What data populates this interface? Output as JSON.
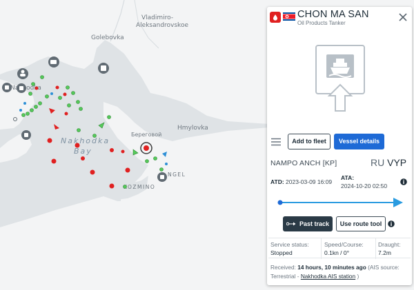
{
  "map": {
    "labels": {
      "vladimiro": "Vladimiro-",
      "aleksandrovskoe": "Aleksandrovskoe",
      "golebovka": "Golebovka",
      "nakhodka_city": "Nakhodka",
      "beregovoi": "Береговой",
      "hmylovka": "Hmylovka",
      "bay_line1": "Nakhodka",
      "bay_line2": "Bay",
      "kozmino": "KOZMINO",
      "nagel": "NGEL"
    },
    "colors": {
      "land": "#f3f4f5",
      "sea": "#dfe3e6",
      "tanker": "#e02020",
      "cargo": "#55c95a",
      "passenger": "#2d8fd6",
      "route": "#2a9be0"
    }
  },
  "panel": {
    "vessel_name": "CHON MA SAN",
    "vessel_type": "Oil Products Tanker",
    "flag": "north-korea-flag",
    "add_to_fleet": "Add to fleet",
    "vessel_details": "Vessel details",
    "departure": "NAMPO ANCH [KP]",
    "dest_country": "RU",
    "dest_port": "VYP",
    "atd_label": "ATD:",
    "atd_value": "2023-03-09 16:09",
    "ata_label": "ATA:",
    "ata_value": "2024-10-20 02:50",
    "progress": 1.0,
    "past_track": "Past track",
    "route_tool": "Use route tool",
    "service_status_label": "Service status:",
    "service_status_value": "Stopped",
    "speed_course_label": "Speed/Course:",
    "speed_course_value": "0.1kn / 0°",
    "draught_label": "Draught:",
    "draught_value": "7.2m",
    "received_label": "Received:",
    "received_value": "14 hours, 10 minutes ago",
    "ais_source_text": "(AIS source: Terrestrial -",
    "ais_station": "Nakhodka AIS station",
    "ais_close": ")"
  }
}
